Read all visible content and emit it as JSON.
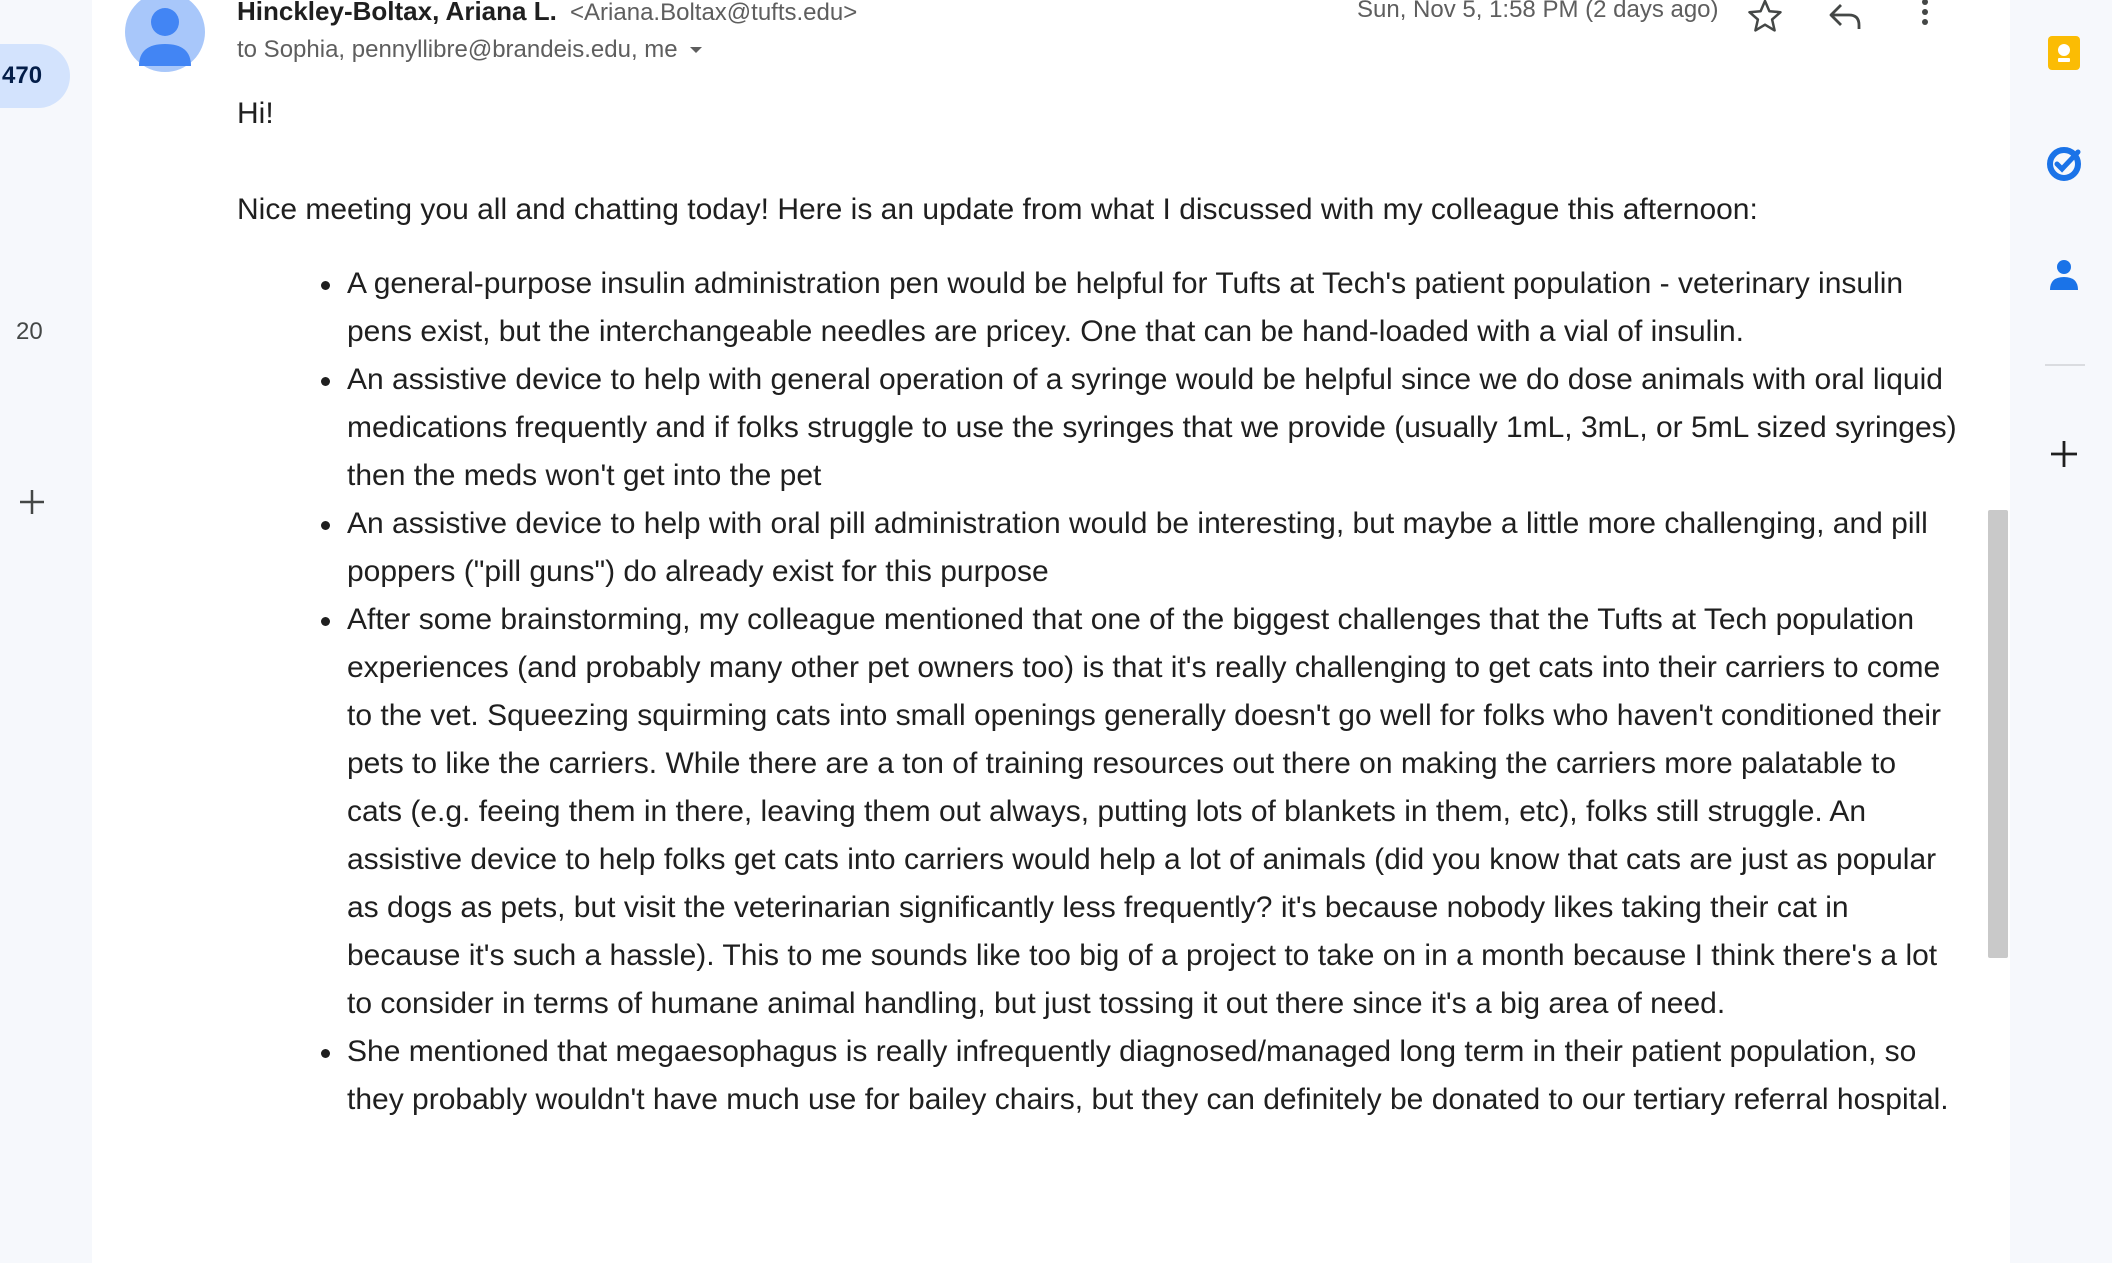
{
  "left_rail": {
    "inbox_count": "470",
    "secondary_count": "20",
    "add_icon": "plus-icon"
  },
  "message": {
    "sender_name": "Hinckley-Boltax, Ariana L.",
    "sender_email": "<Ariana.Boltax@tufts.edu>",
    "recipients": "to Sophia, pennyllibre@brandeis.edu, me",
    "date": "Sun, Nov 5, 1:58 PM (2 days ago)",
    "greeting": "Hi!",
    "intro": "Nice meeting you all and chatting today! Here is an update from what I discussed with my colleague this afternoon:",
    "items": [
      "A general-purpose insulin administration pen would be helpful for Tufts at Tech's patient population - veterinary insulin pens exist, but the interchangeable needles are pricey. One that can be hand-loaded with a vial of insulin.",
      "An assistive device to help with general operation of a syringe would be helpful since we do dose animals with oral liquid medications frequently and if folks struggle to use the syringes that we provide (usually 1mL, 3mL, or 5mL sized syringes) then the meds won't get into the pet",
      "An assistive device to help with oral pill administration would be interesting, but maybe a little more challenging, and pill poppers (\"pill guns\") do already exist for this purpose",
      "After some brainstorming, my colleague mentioned that one of the biggest challenges that the Tufts at Tech population experiences (and probably many other pet owners too) is that it's really challenging to get cats into their carriers to come to the vet. Squeezing squirming cats into small openings generally doesn't go well for folks who haven't conditioned their pets to like the carriers. While there are a ton of training resources out there on making the carriers more palatable to cats (e.g. feeing them in there, leaving them out always, putting lots of blankets in them, etc), folks still struggle. An assistive device to help folks get cats into carriers would help a lot of animals (did you know that cats are just as popular as dogs as pets, but visit the veterinarian significantly less frequently? it's because nobody likes taking their cat in because it's such a hassle). This to me sounds like too big of a project to take on in a month because I think there's a lot to consider in terms of humane animal handling, but just tossing it out there since it's a big area of need.",
      "She mentioned that megaesophagus is really infrequently diagnosed/managed long term in their patient population, so they probably wouldn't have much use for bailey chairs, but they can definitely be donated to our tertiary referral hospital."
    ]
  },
  "side_panel": {
    "icons": [
      "keep-icon",
      "tasks-icon",
      "contacts-icon",
      "plus-icon"
    ]
  },
  "colors": {
    "badge_bg": "#d3e3fd",
    "avatar": "#a8c7fa",
    "keep": "#fbbc04",
    "tasks": "#1a73e8",
    "contacts": "#1a73e8"
  }
}
